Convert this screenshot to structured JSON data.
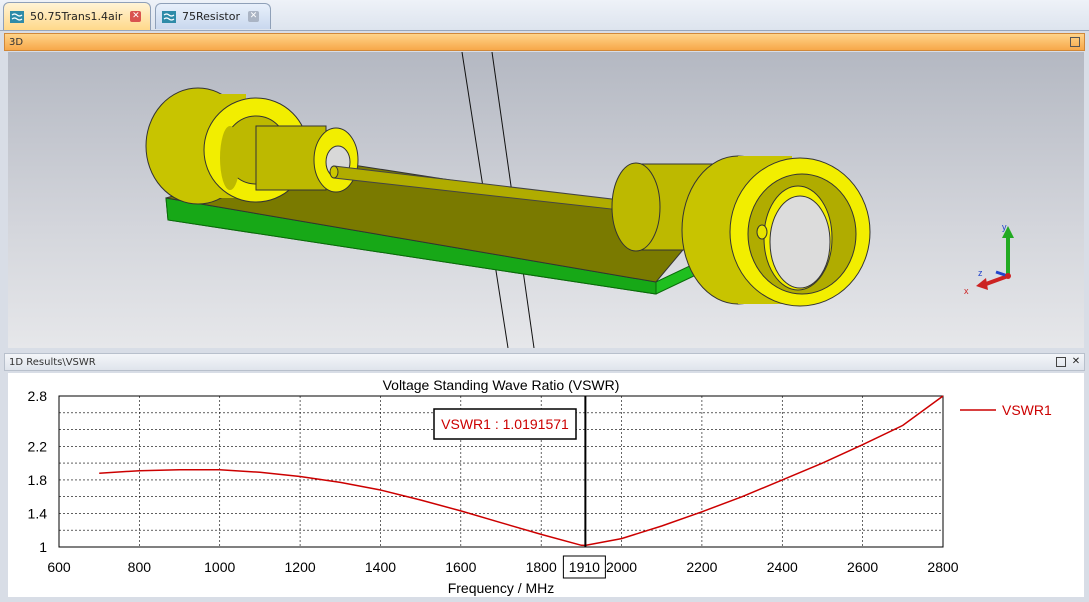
{
  "tabs": [
    {
      "label": "50.75Trans1.4air",
      "active": true
    },
    {
      "label": "75Resistor",
      "active": false
    }
  ],
  "panel_3d": {
    "title": "3D"
  },
  "panel_1d": {
    "title": "1D Results\\VSWR"
  },
  "axes_triad": {
    "x": "x",
    "y": "y",
    "z": "z"
  },
  "chart_data": {
    "type": "line",
    "title": "Voltage Standing Wave Ratio (VSWR)",
    "xlabel": "Frequency / MHz",
    "ylabel": "",
    "xlim": [
      600,
      2800
    ],
    "ylim": [
      1,
      2.8
    ],
    "x_ticks": [
      "600",
      "800",
      "1000",
      "1200",
      "1400",
      "1600",
      "1800",
      "2000",
      "2200",
      "2400",
      "2600",
      "2800"
    ],
    "y_ticks": [
      "1",
      "1.4",
      "1.8",
      "2.2",
      "2.8"
    ],
    "grid": true,
    "legend_position": "right",
    "series": [
      {
        "name": "VSWR1",
        "color": "#cc0000",
        "x": [
          700,
          800,
          900,
          1000,
          1100,
          1200,
          1300,
          1400,
          1500,
          1600,
          1700,
          1800,
          1900,
          1910,
          2000,
          2100,
          2200,
          2300,
          2400,
          2500,
          2600,
          2700,
          2800
        ],
        "y": [
          1.88,
          1.91,
          1.92,
          1.92,
          1.89,
          1.84,
          1.77,
          1.68,
          1.56,
          1.43,
          1.29,
          1.15,
          1.02,
          1.0192,
          1.1,
          1.25,
          1.42,
          1.6,
          1.8,
          2.0,
          2.22,
          2.45,
          2.8
        ]
      }
    ],
    "marker": {
      "x": "1910",
      "label": "VSWR1 : 1.0191571"
    }
  }
}
